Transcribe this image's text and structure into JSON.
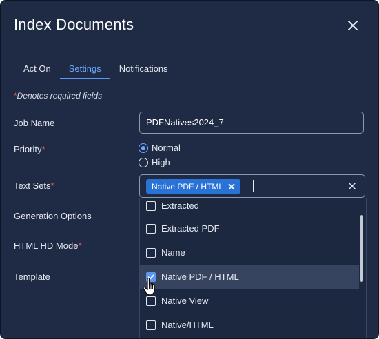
{
  "dialog": {
    "title": "Index Documents",
    "close_icon": "close-icon"
  },
  "tabs": [
    {
      "label": "Act On",
      "active": false
    },
    {
      "label": "Settings",
      "active": true
    },
    {
      "label": "Notifications",
      "active": false
    }
  ],
  "required_note": {
    "star": "*",
    "text": "Denotes required fields"
  },
  "form": {
    "job_name": {
      "label": "Job Name",
      "value": "PDFNatives2024_7"
    },
    "priority": {
      "label": "Priority",
      "star": "*",
      "options": [
        {
          "label": "Normal",
          "selected": true
        },
        {
          "label": "High",
          "selected": false
        }
      ]
    },
    "text_sets": {
      "label": "Text Sets",
      "star": "*",
      "selected_chip": "Native PDF / HTML",
      "options": [
        {
          "label": "Extracted",
          "checked": false
        },
        {
          "label": "Extracted PDF",
          "checked": false
        },
        {
          "label": "Name",
          "checked": false
        },
        {
          "label": "Native PDF / HTML",
          "checked": true
        },
        {
          "label": "Native View",
          "checked": false
        },
        {
          "label": "Native/HTML",
          "checked": false
        }
      ]
    },
    "generation_options": {
      "label": "Generation Options"
    },
    "html_hd_mode": {
      "label": "HTML HD Mode",
      "star": "*"
    },
    "template": {
      "label": "Template"
    }
  },
  "colors": {
    "background": "#1f2a44",
    "accent": "#5b97f0",
    "required": "#ff5a5a",
    "chip": "#2a73d6"
  }
}
